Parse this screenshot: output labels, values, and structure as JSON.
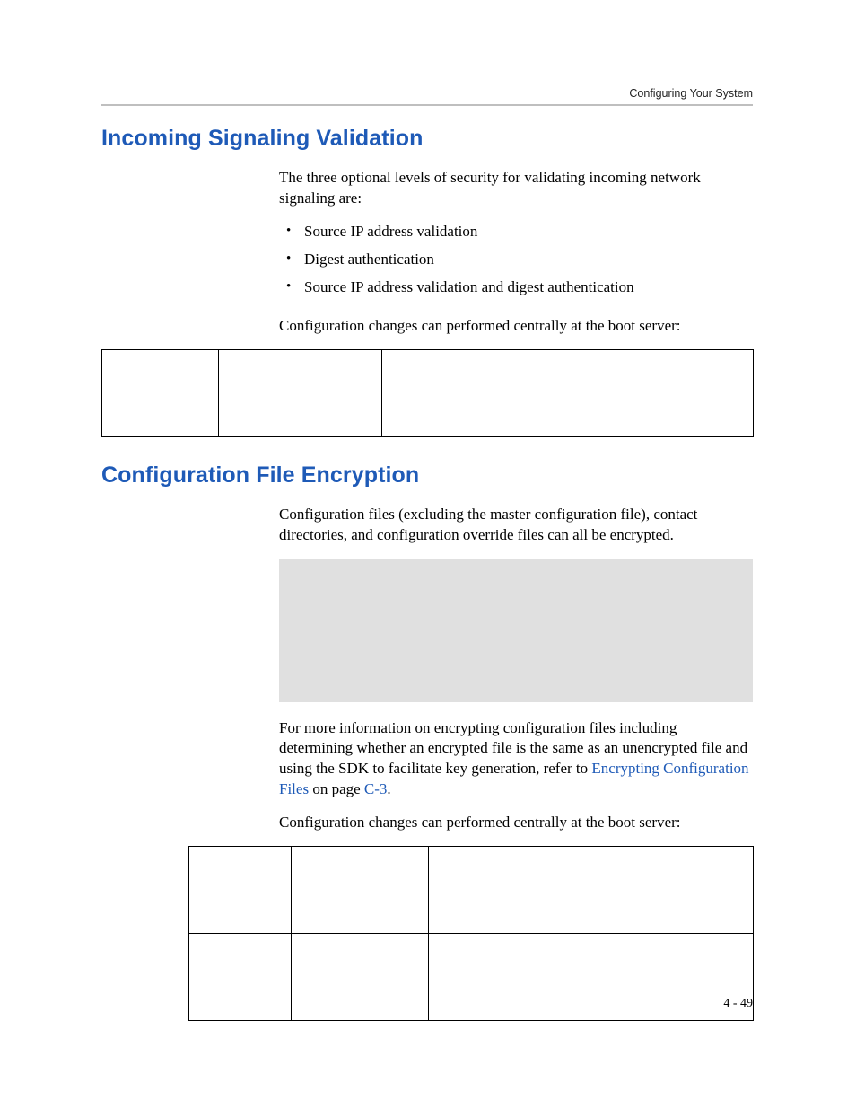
{
  "runningHead": "Configuring Your System",
  "section1": {
    "title": "Incoming Signaling Validation",
    "intro": "The three optional levels of security for validating incoming network signaling are:",
    "bullets": [
      "Source IP address validation",
      "Digest authentication",
      "Source IP address validation and digest authentication"
    ],
    "outro": "Configuration changes can performed centrally at the boot server:"
  },
  "section2": {
    "title": "Configuration File Encryption",
    "p1": "Configuration files (excluding the master configuration file), contact directories, and configuration override files can all be encrypted.",
    "p2a": "For more information on encrypting configuration files including determining whether an encrypted file is the same as an unencrypted file and using the SDK to facilitate key generation, refer to ",
    "link1": "Encrypting Configuration Files",
    "p2b": " on page ",
    "link2": "C-3",
    "p2c": ".",
    "outro": "Configuration changes can performed centrally at the boot server:"
  },
  "pageNumber": "4 - 49"
}
